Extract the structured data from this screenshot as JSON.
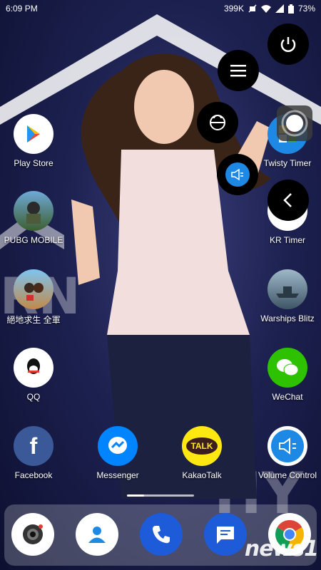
{
  "status_bar": {
    "time": "6:09 PM",
    "speed": "399K",
    "battery": "73%",
    "icons": [
      "data-speed",
      "mute-icon",
      "wifi-icon",
      "signal-icon",
      "battery-icon"
    ]
  },
  "apps": [
    {
      "label": "Play Store",
      "icon": "play-store-icon"
    },
    {
      "label": "Twisty Timer",
      "icon": "twisty-timer-icon"
    },
    {
      "label": "PUBG MOBILE",
      "icon": "pubg-mobile-icon"
    },
    {
      "label": "KR Timer",
      "icon": "kr-timer-icon"
    },
    {
      "label": "絕地求生 全軍",
      "icon": "pubg-cn-icon"
    },
    {
      "label": "Warships Blitz",
      "icon": "warships-blitz-icon"
    },
    {
      "label": "QQ",
      "icon": "qq-icon"
    },
    {
      "label": "WeChat",
      "icon": "wechat-icon"
    },
    {
      "label": "Facebook",
      "icon": "facebook-icon"
    },
    {
      "label": "Messenger",
      "icon": "messenger-icon"
    },
    {
      "label": "KakaoTalk",
      "icon": "kakaotalk-icon",
      "icon_text": "TALK"
    },
    {
      "label": "Volume Control",
      "icon": "volume-control-icon"
    }
  ],
  "floating_menu": [
    "power-icon",
    "menu-icon",
    "lock-icon",
    "volume-icon",
    "back-icon",
    "assistive-touch-icon"
  ],
  "dock": [
    "camera-icon",
    "contacts-icon",
    "phone-icon",
    "messages-icon",
    "chrome-icon"
  ],
  "watermark": "news1",
  "colors": {
    "kakao": "#ffe812",
    "facebook": "#3b5998",
    "messenger": "#0084ff",
    "wechat": "#2dc100",
    "phone": "#1e5bd8"
  }
}
